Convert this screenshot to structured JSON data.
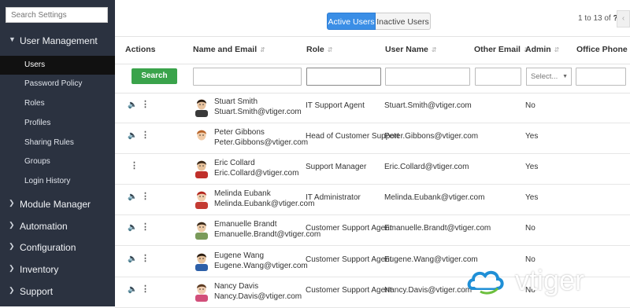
{
  "sidebar": {
    "search_placeholder": "Search Settings",
    "groups": [
      {
        "label": "User Management",
        "expanded": true
      },
      {
        "label": "Module Manager",
        "expanded": false
      },
      {
        "label": "Automation",
        "expanded": false
      },
      {
        "label": "Configuration",
        "expanded": false
      },
      {
        "label": "Inventory",
        "expanded": false
      },
      {
        "label": "Support",
        "expanded": false
      }
    ],
    "user_management_items": [
      "Users",
      "Password Policy",
      "Roles",
      "Profiles",
      "Sharing Rules",
      "Groups",
      "Login History"
    ],
    "active_item": "Users"
  },
  "toggle": {
    "active": "Active Users",
    "inactive": "Inactive Users"
  },
  "pager": {
    "range": "1 to 13",
    "of": "of",
    "total": "?"
  },
  "table": {
    "headers": [
      "Actions",
      "Name and Email",
      "Role",
      "User Name",
      "Other Email",
      "Admin",
      "Office Phone"
    ],
    "search_label": "Search",
    "admin_select_placeholder": "Select...",
    "rows": [
      {
        "name": "Stuart Smith",
        "email": "Stuart.Smith@vtiger.com",
        "role": "IT Support Agent",
        "username": "Stuart.Smith@vtiger.com",
        "admin": "No",
        "avatar": "man-dark-hair"
      },
      {
        "name": "Peter Gibbons",
        "email": "Peter.Gibbons@vtiger.com",
        "role": "Head of Customer Support",
        "username": "Peter.Gibbons@vtiger.com",
        "admin": "Yes",
        "avatar": "man-ginger"
      },
      {
        "name": "Eric Collard",
        "email": "Eric.Collard@vtiger.com",
        "role": "Support Manager",
        "username": "Eric.Collard@vtiger.com",
        "admin": "Yes",
        "avatar": "man-red-shirt"
      },
      {
        "name": "Melinda Eubank",
        "email": "Melinda.Eubank@vtiger.com",
        "role": "IT Administrator",
        "username": "Melinda.Eubank@vtiger.com",
        "admin": "Yes",
        "avatar": "woman-red-hair"
      },
      {
        "name": "Emanuelle Brandt",
        "email": "Emanuelle.Brandt@vtiger.com",
        "role": "Customer Support Agent",
        "username": "Emanuelle.Brandt@vtiger.com",
        "admin": "No",
        "avatar": "man-glasses"
      },
      {
        "name": "Eugene Wang",
        "email": "Eugene.Wang@vtiger.com",
        "role": "Customer Support Agent",
        "username": "Eugene.Wang@vtiger.com",
        "admin": "No",
        "avatar": "man-blue-shirt"
      },
      {
        "name": "Nancy Davis",
        "email": "Nancy.Davis@vtiger.com",
        "role": "Customer Support Agent",
        "username": "Nancy.Davis@vtiger.com",
        "admin": "No",
        "avatar": "woman-brown-hair"
      }
    ]
  },
  "logo": {
    "text": "vtiger"
  },
  "colors": {
    "sidebar_bg": "#2b3240",
    "active_item_bg": "#111111",
    "primary_blue": "#3a8ee6",
    "search_green": "#3aa34b"
  }
}
